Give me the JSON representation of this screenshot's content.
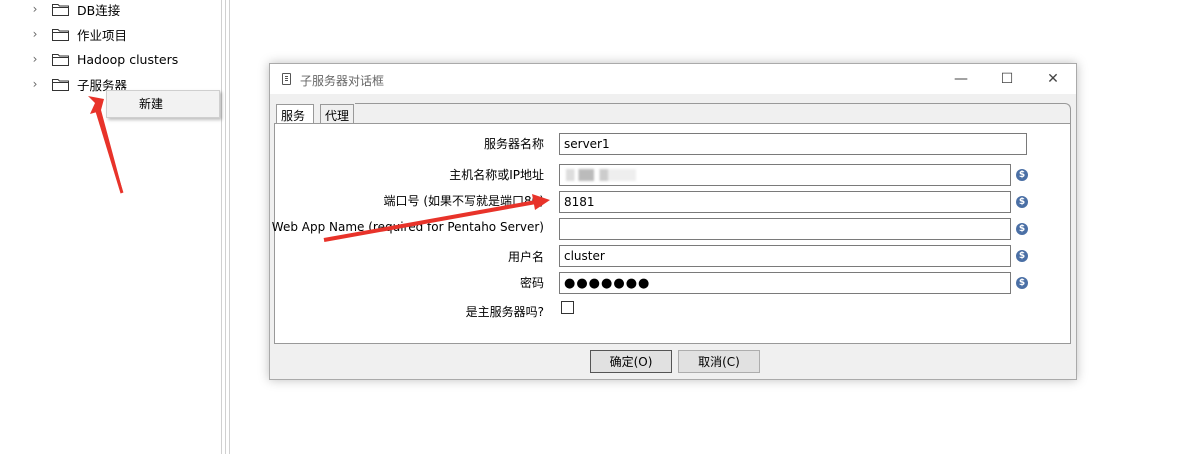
{
  "tree": {
    "items": [
      {
        "label": "DB连接"
      },
      {
        "label": "作业项目"
      },
      {
        "label": "Hadoop clusters"
      },
      {
        "label": "子服务器"
      }
    ]
  },
  "context_menu": {
    "items": [
      {
        "label": "新建"
      }
    ]
  },
  "dialog": {
    "title": "子服务器对话框",
    "tabs": [
      {
        "label": "服务"
      },
      {
        "label": "代理"
      }
    ],
    "fields": {
      "server_name": {
        "label": "服务器名称",
        "value": "server1"
      },
      "hostname": {
        "label": "主机名称或IP地址",
        "value": ""
      },
      "port": {
        "label": "端口号 (如果不写就是端口80)",
        "value": "8181"
      },
      "webapp": {
        "label": "Web App Name (required for Pentaho Server)",
        "value": ""
      },
      "username": {
        "label": "用户名",
        "value": "cluster"
      },
      "password": {
        "label": "密码",
        "value": "●●●●●●●"
      },
      "is_master": {
        "label": "是主服务器吗?",
        "checked": false
      }
    },
    "buttons": {
      "ok": "确定(O)",
      "cancel": "取消(C)"
    },
    "window_controls": {
      "minimize": "—",
      "maximize": "☐",
      "close": "✕"
    }
  },
  "colors": {
    "selection": "#cce8ff",
    "arrow": "#e8332a",
    "variable_icon": "#4a6fa5"
  }
}
